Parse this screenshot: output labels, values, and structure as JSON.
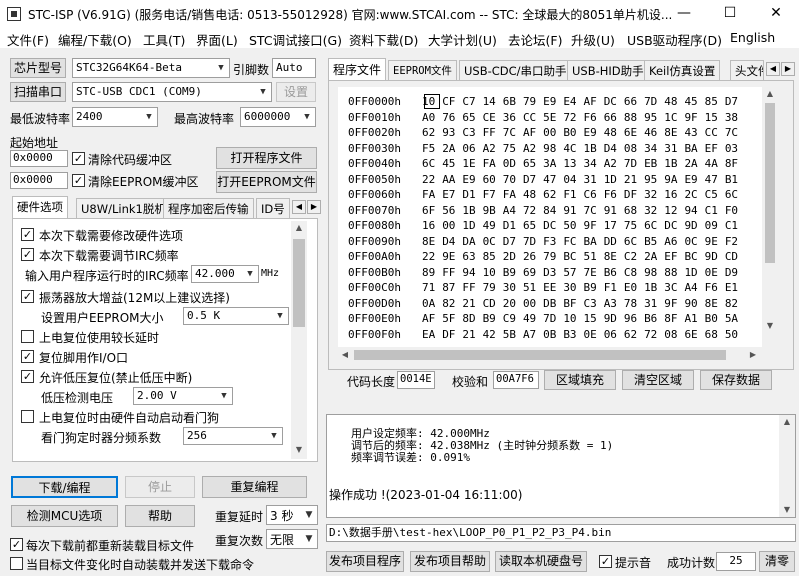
{
  "window": {
    "title": "STC-ISP (V6.91G) (服务电话/销售电话: 0513-55012928) 官网:www.STCAI.com  -- STC: 全球最大的8051单片机设...",
    "minimize": "—",
    "maximize": "☐",
    "close": "✕"
  },
  "menu": [
    "文件(F)",
    "编程/下载(O)",
    "工具(T)",
    "界面(L)",
    "STC调试接口(G)",
    "资料下载(D)",
    "大学计划(U)",
    "去论坛(F)",
    "升级(U)",
    "USB驱动程序(D)",
    "English"
  ],
  "left": {
    "chip_button": "芯片型号",
    "chip_value": "STC32G64K64-Beta",
    "pin_label": "引脚数",
    "pin_value": "Auto",
    "scan_button": "扫描串口",
    "port_value": "STC-USB CDC1 (COM9)",
    "settings_button": "设置",
    "min_baud_label": "最低波特率",
    "min_baud_value": "2400",
    "max_baud_label": "最高波特率",
    "max_baud_value": "6000000",
    "start_addr_label": "起始地址",
    "code_addr": "0x0000",
    "clear_code_label": "清除代码缓冲区",
    "open_prog_button": "打开程序文件",
    "eeprom_addr": "0x0000",
    "clear_eeprom_label": "清除EEPROM缓冲区",
    "open_eeprom_button": "打开EEPROM文件",
    "option_tabs": [
      "硬件选项",
      "U8W/Link1脱机",
      "程序加密后传输",
      "ID号"
    ],
    "hw": {
      "opt1": "本次下载需要修改硬件选项",
      "opt2": "本次下载需要调节IRC频率",
      "irc_label": "输入用户程序运行时的IRC频率",
      "irc_value": "42.000",
      "irc_unit": "MHz",
      "opt3": "振荡器放大增益(12M以上建议选择)",
      "eeprom_size_label": "设置用户EEPROM大小",
      "eeprom_size_value": "0.5 K",
      "opt4": "上电复位使用较长延时",
      "opt5": "复位脚用作I/O口",
      "opt6": "允许低压复位(禁止低压中断)",
      "lvd_label": "低压检测电压",
      "lvd_value": "2.00 V",
      "opt7": "上电复位时由硬件自动启动看门狗",
      "wdt_label": "看门狗定时器分频系数",
      "wdt_value": "256"
    },
    "download_button": "下载/编程",
    "stop_button": "停止",
    "reprogram_button": "重复编程",
    "detect_button": "检测MCU选项",
    "help_button": "帮助",
    "repeat_delay_label": "重复延时",
    "repeat_delay_value": "3 秒",
    "repeat_count_label": "重复次数",
    "repeat_count_value": "无限",
    "reload_label": "每次下载前都重新装载目标文件",
    "autosend_label": "当目标文件变化时自动装载并发送下载命令"
  },
  "right": {
    "tabs": [
      "程序文件",
      "EEPROM文件",
      "USB-CDC/串口助手",
      "USB-HID助手",
      "Keil仿真设置",
      "头文件"
    ],
    "hex_rows": [
      {
        "addr": "0FF0000h",
        "bytes": [
          "10",
          "CF",
          "C7",
          "14",
          "6B",
          "79",
          "E9",
          "E4",
          "AF",
          "DC",
          "66",
          "7D",
          "48",
          "45",
          "85",
          "D7"
        ]
      },
      {
        "addr": "0FF0010h",
        "bytes": [
          "A0",
          "76",
          "65",
          "CE",
          "36",
          "CC",
          "5E",
          "72",
          "F6",
          "66",
          "88",
          "95",
          "1C",
          "9F",
          "15",
          "38"
        ]
      },
      {
        "addr": "0FF0020h",
        "bytes": [
          "62",
          "93",
          "C3",
          "FF",
          "7C",
          "AF",
          "00",
          "B0",
          "E9",
          "48",
          "6E",
          "46",
          "8E",
          "43",
          "CC",
          "7C"
        ]
      },
      {
        "addr": "0FF0030h",
        "bytes": [
          "F5",
          "2A",
          "06",
          "A2",
          "75",
          "A2",
          "98",
          "4C",
          "1B",
          "D4",
          "08",
          "34",
          "31",
          "BA",
          "EF",
          "03"
        ]
      },
      {
        "addr": "0FF0040h",
        "bytes": [
          "6C",
          "45",
          "1E",
          "FA",
          "0D",
          "65",
          "3A",
          "13",
          "34",
          "A2",
          "7D",
          "EB",
          "1B",
          "2A",
          "4A",
          "8F"
        ]
      },
      {
        "addr": "0FF0050h",
        "bytes": [
          "22",
          "AA",
          "E9",
          "60",
          "70",
          "D7",
          "47",
          "04",
          "31",
          "1D",
          "21",
          "95",
          "9A",
          "E9",
          "47",
          "B1"
        ]
      },
      {
        "addr": "0FF0060h",
        "bytes": [
          "FA",
          "E7",
          "D1",
          "F7",
          "FA",
          "48",
          "62",
          "F1",
          "C6",
          "F6",
          "DF",
          "32",
          "16",
          "2C",
          "C5",
          "6C"
        ]
      },
      {
        "addr": "0FF0070h",
        "bytes": [
          "6F",
          "56",
          "1B",
          "9B",
          "A4",
          "72",
          "84",
          "91",
          "7C",
          "91",
          "68",
          "32",
          "12",
          "94",
          "C1",
          "F0"
        ]
      },
      {
        "addr": "0FF0080h",
        "bytes": [
          "16",
          "00",
          "1D",
          "49",
          "D1",
          "65",
          "DC",
          "50",
          "9F",
          "17",
          "75",
          "6C",
          "DC",
          "9D",
          "09",
          "C1"
        ]
      },
      {
        "addr": "0FF0090h",
        "bytes": [
          "8E",
          "D4",
          "DA",
          "0C",
          "D7",
          "7D",
          "F3",
          "FC",
          "BA",
          "DD",
          "6C",
          "B5",
          "A6",
          "0C",
          "9E",
          "F2"
        ]
      },
      {
        "addr": "0FF00A0h",
        "bytes": [
          "22",
          "9E",
          "63",
          "85",
          "2D",
          "26",
          "79",
          "BC",
          "51",
          "8E",
          "C2",
          "2A",
          "EF",
          "BC",
          "9D",
          "CD"
        ]
      },
      {
        "addr": "0FF00B0h",
        "bytes": [
          "89",
          "FF",
          "94",
          "10",
          "B9",
          "69",
          "D3",
          "57",
          "7E",
          "B6",
          "C8",
          "98",
          "88",
          "1D",
          "0E",
          "D9"
        ]
      },
      {
        "addr": "0FF00C0h",
        "bytes": [
          "71",
          "87",
          "FF",
          "79",
          "30",
          "51",
          "EE",
          "30",
          "B9",
          "F1",
          "E0",
          "1B",
          "3C",
          "A4",
          "F6",
          "E1"
        ]
      },
      {
        "addr": "0FF00D0h",
        "bytes": [
          "0A",
          "82",
          "21",
          "CD",
          "20",
          "00",
          "DB",
          "BF",
          "C3",
          "A3",
          "78",
          "31",
          "9F",
          "90",
          "8E",
          "82"
        ]
      },
      {
        "addr": "0FF00E0h",
        "bytes": [
          "AF",
          "5F",
          "8D",
          "B9",
          "C9",
          "49",
          "7D",
          "10",
          "15",
          "9D",
          "96",
          "B6",
          "8F",
          "A1",
          "B0",
          "5A"
        ]
      },
      {
        "addr": "0FF00F0h",
        "bytes": [
          "EA",
          "DF",
          "21",
          "42",
          "5B",
          "A7",
          "0B",
          "B3",
          "0E",
          "06",
          "62",
          "72",
          "08",
          "6E",
          "68",
          "50"
        ]
      }
    ],
    "code_len_label": "代码长度",
    "code_len_value": "0014E",
    "checksum_label": "校验和",
    "checksum_value": "00A7F6",
    "fill_button": "区域填充",
    "clear_button": "清空区域",
    "save_button": "保存数据",
    "log_line1": "用户设定频率: 42.000MHz",
    "log_line2": "调节后的频率: 42.038MHz (主时钟分频系数 = 1)",
    "log_line3": "频率调节误差: 0.091%",
    "log_result": "操作成功 !(2023-01-04 16:11:00)",
    "file_path": "D:\\数据手册\\test-hex\\LOOP_P0_P1_P2_P3_P4.bin",
    "publish_prog_button": "发布项目程序",
    "publish_help_button": "发布项目帮助",
    "read_serial_button": "读取本机硬盘号",
    "beep_label": "提示音",
    "success_count_label": "成功计数",
    "success_count_value": "25",
    "clear_count_button": "清零"
  }
}
